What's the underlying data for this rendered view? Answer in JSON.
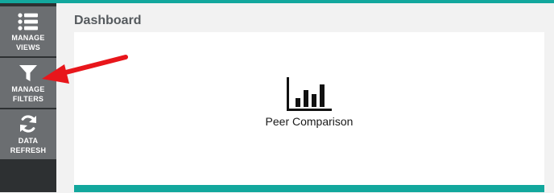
{
  "sidebar": {
    "items": [
      {
        "label_line1": "MANAGE",
        "label_line2": "VIEWS",
        "icon": "list-icon"
      },
      {
        "label_line1": "MANAGE",
        "label_line2": "FILTERS",
        "icon": "filter-icon"
      },
      {
        "label_line1": "DATA",
        "label_line2": "REFRESH",
        "icon": "refresh-icon"
      }
    ]
  },
  "main": {
    "title": "Dashboard",
    "widget": {
      "label": "Peer Comparison",
      "icon": "bar-chart-icon"
    }
  },
  "colors": {
    "accent": "#12a79d",
    "sidebar_bg": "#2d3032",
    "sidebar_button": "#6b6e71",
    "annotation_arrow": "#e8161b"
  }
}
